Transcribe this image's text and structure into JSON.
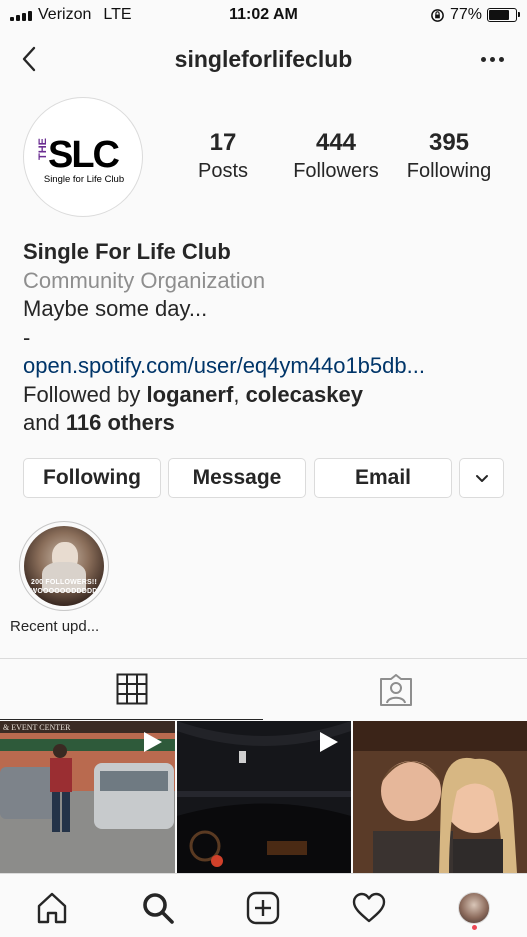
{
  "status_bar": {
    "carrier": "Verizon",
    "network": "LTE",
    "time": "11:02 AM",
    "battery": "77%",
    "battery_level": 0.77
  },
  "header": {
    "username": "singleforlifeclub"
  },
  "avatar": {
    "logo_top": "THE",
    "logo_main": "SLC",
    "logo_sub": "Single for Life Club"
  },
  "stats": [
    {
      "value": "17",
      "label": "Posts"
    },
    {
      "value": "444",
      "label": "Followers"
    },
    {
      "value": "395",
      "label": "Following"
    }
  ],
  "bio": {
    "name": "Single For Life Club",
    "category": "Community Organization",
    "text": "Maybe some day...",
    "separator": "-",
    "link": "open.spotify.com/user/eq4ym44o1b5db...",
    "followed_by_prefix": "Followed by",
    "followed_user_1": "loganerf",
    "comma": ",",
    "followed_user_2": "colecaskey",
    "and_text": "and",
    "others": "116 others"
  },
  "actions": {
    "following": "Following",
    "message": "Message",
    "email": "Email"
  },
  "highlights": [
    {
      "label": "Recent upd...",
      "overlay_text_1": "200 FOLLOWERS!!",
      "overlay_text_2": "WOOOOOODDDDD"
    }
  ],
  "grid_posts": [
    {
      "sign_text": "& EVENT CENTER"
    },
    {
      "sign_text": ""
    },
    {
      "sign_text": ""
    }
  ],
  "colors": {
    "accent_link": "#003569",
    "border": "#dbdbdb",
    "muted": "#8e8e8e",
    "notification": "#ed4956",
    "logo_purple": "#6a2c91"
  }
}
